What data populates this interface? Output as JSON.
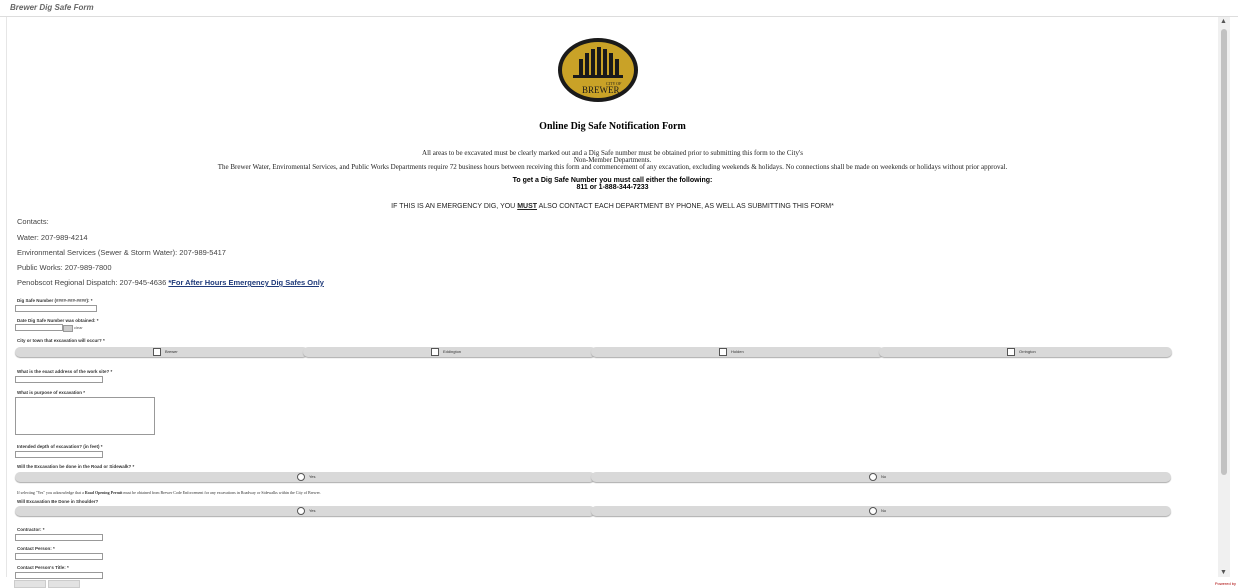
{
  "window": {
    "title": "Brewer Dig Safe Form"
  },
  "logo": {
    "line1": "CITY OF",
    "line2": "BREWER"
  },
  "form_title": "Online Dig Safe Notification Form",
  "intro": {
    "line1": "All areas to be excavated must be clearly marked out and a Dig Safe number must be obtained prior to submitting this form to the City's",
    "line2": "Non-Member Departments.",
    "line3": "The Brewer Water, Enviromental Services, and Public Works Departments require 72 business hours between receiving this form and commencement of any excavation, excluding weekends & holidays. No connections shall be made on weekends or holidays without prior approval."
  },
  "dig_safe_call": {
    "line1": "To get a Dig Safe Number you must call either the following:",
    "line2": "811 or 1-888-344-7233"
  },
  "emergency": {
    "pre": "IF THIS IS AN EMERGENCY DIG, YOU ",
    "must": "MUST",
    "post": " ALSO CONTACT EACH DEPARTMENT BY PHONE, AS WELL AS SUBMITTING THIS FORM*"
  },
  "contacts": {
    "heading": "Contacts:",
    "water": "Water: 207-989-4214",
    "env": "Environmental Services (Sewer & Storm Water): 207-989-5417",
    "public_works": "Public Works: 207-989-7800",
    "dispatch": "Penobscot Regional Dispatch: 207-945-4636 ",
    "dispatch_link": "*For After Hours Emergency Dig Safes Only"
  },
  "fields": {
    "dig_safe_number": "Dig Safe Number (####-###-####): *",
    "date_obtained": "Date Dig Safe Number was obtained: *",
    "date_clear": "clear",
    "city_question": "City or town that excavation will occur? *",
    "cities": [
      "Brewer",
      "Eddington",
      "Holden",
      "Orrington"
    ],
    "address": "What is the exact address of the work site? *",
    "purpose": "What is purpose of excavation *",
    "depth": "Intended depth of excavation? (in feet) *",
    "road_question": "Will the Excavation be done in the Road or Sidewalk? *",
    "yes": "Yes",
    "no": "No",
    "road_note_pre": "If selecting \"Yes\" you acknowledge that a ",
    "road_note_bold": "Road Opening Permit",
    "road_note_post": " must be obtained from Brewer Code Enforcement for any excavations in Roadway or Sidewalks within the City of Brewer.",
    "shoulder_question": "Will Excavation Be Done in Shoulder?",
    "contractor": "Contractor: *",
    "contact_person": "Contact Person: *",
    "contact_title": "Contact Person's Title: *"
  },
  "footer": {
    "right_label": "Powered by"
  },
  "colors": {
    "accent_link": "#1f3a7a",
    "row_bg": "#d9d9d9",
    "scroll_thumb": "#c2c2c2"
  }
}
